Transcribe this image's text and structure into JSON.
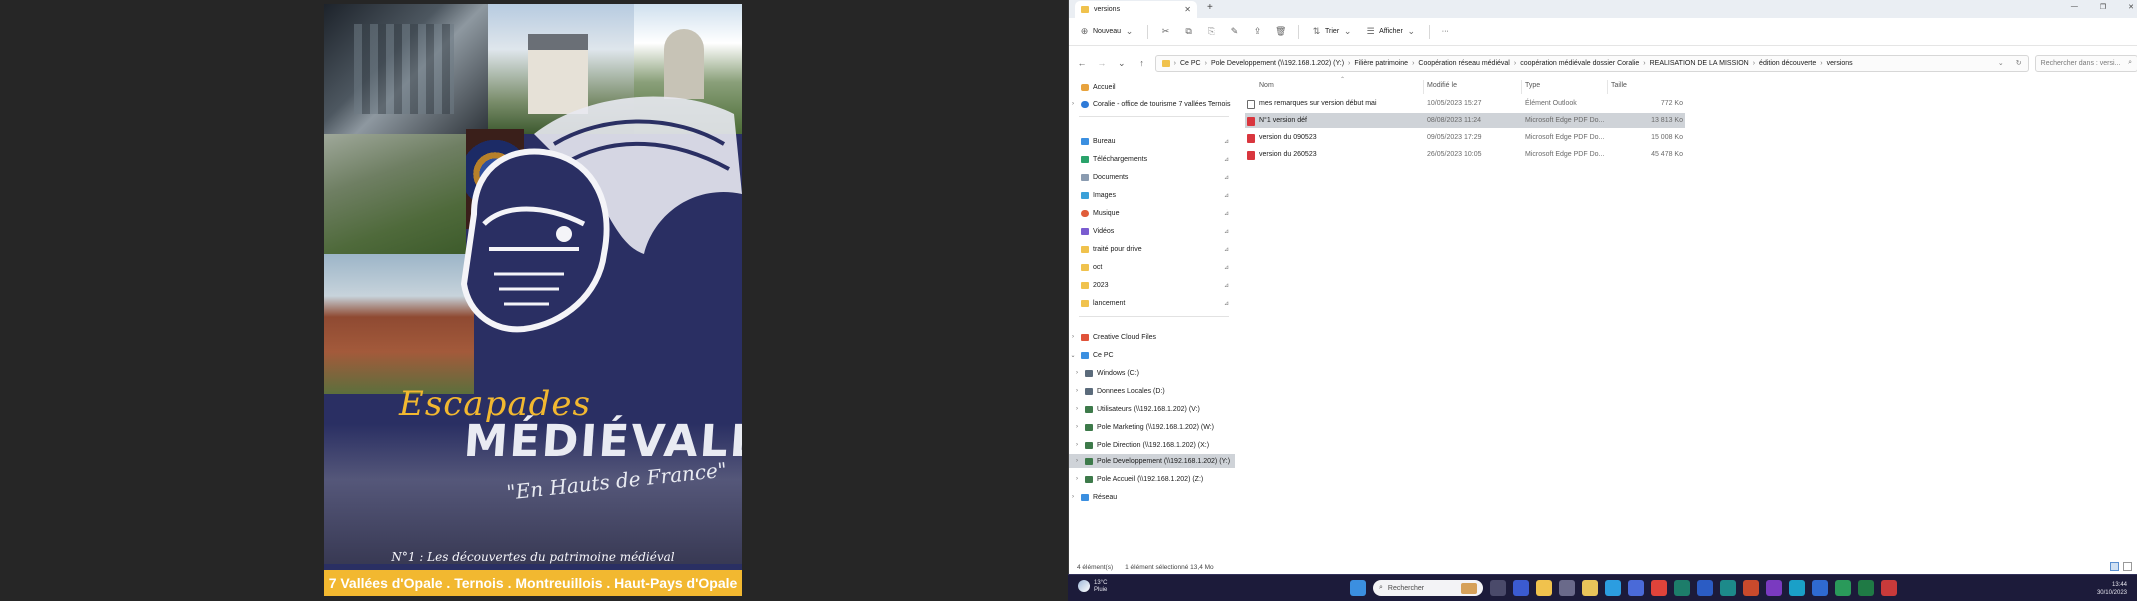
{
  "viewer": {
    "cover": {
      "title_line1": "Escapades",
      "title_line2": "MÉDIÉVALES",
      "title_line3": "\"En Hauts de France\"",
      "subtitle": "N°1 : Les découvertes du patrimoine médiéval",
      "banner": "7 Vallées d'Opale . Ternois . Montreuillois . Haut-Pays d'Opale",
      "colors": {
        "navy": "#2a2f63",
        "gold": "#f2b830"
      }
    }
  },
  "explorer": {
    "tab": {
      "label": "versions",
      "close": "✕",
      "new": "+"
    },
    "window_controls": [
      "—",
      "❐",
      "✕"
    ],
    "toolbar": {
      "new_label": "Nouveau",
      "sort_label": "Trier",
      "view_label": "Afficher",
      "more_label": "···"
    },
    "breadcrumb": [
      "Ce PC",
      "Pole Developpement (\\\\192.168.1.202) (Y:)",
      "Filière patrimoine",
      "Coopération réseau médiéval",
      "coopération médiévale dossier Coralie",
      "REALISATION DE LA MISSION",
      "édition découverte",
      "versions"
    ],
    "search_placeholder": "Rechercher dans : versi...",
    "nav": {
      "home": "Accueil",
      "onedrive": "Coralie - office de tourisme 7 vallées Ternois",
      "quick": [
        "Bureau",
        "Téléchargements",
        "Documents",
        "Images",
        "Musique",
        "Vidéos",
        "traité pour drive",
        "oct",
        "2023",
        "lancement"
      ],
      "creative_cloud": "Creative Cloud Files",
      "this_pc": "Ce PC",
      "drives": [
        "Windows (C:)",
        "Donnees Locales (D:)",
        "Utilisateurs (\\\\192.168.1.202) (V:)",
        "Pole Marketing (\\\\192.168.1.202) (W:)",
        "Pole Direction (\\\\192.168.1.202) (X:)",
        "Pole Developpement (\\\\192.168.1.202) (Y:)",
        "Pole Accueil (\\\\192.168.1.202) (Z:)"
      ],
      "network": "Réseau"
    },
    "columns": {
      "name": "Nom",
      "date": "Modifié le",
      "type": "Type",
      "size": "Taille"
    },
    "files": [
      {
        "name": "mes remarques sur version début mai",
        "date": "10/05/2023 15:27",
        "type": "Élément Outlook",
        "size": "772 Ko",
        "icon": "outlook-item-icon",
        "selected": false
      },
      {
        "name": "N°1 version déf",
        "date": "08/08/2023 11:24",
        "type": "Microsoft Edge PDF Do...",
        "size": "13 813 Ko",
        "icon": "pdf-icon",
        "selected": true
      },
      {
        "name": "version du 090523",
        "date": "09/05/2023 17:29",
        "type": "Microsoft Edge PDF Do...",
        "size": "15 008 Ko",
        "icon": "pdf-icon",
        "selected": false
      },
      {
        "name": "version du 260523",
        "date": "26/05/2023 10:05",
        "type": "Microsoft Edge PDF Do...",
        "size": "45 478 Ko",
        "icon": "pdf-icon",
        "selected": false
      }
    ],
    "status": {
      "count": "4 élément(s)",
      "selection": "1 élément sélectionné  13,4 Mo"
    }
  },
  "taskbar": {
    "weather_temp": "13°C",
    "weather_desc": "Pluie",
    "search_placeholder": "Rechercher",
    "time": "13:44",
    "date": "30/10/2023"
  }
}
